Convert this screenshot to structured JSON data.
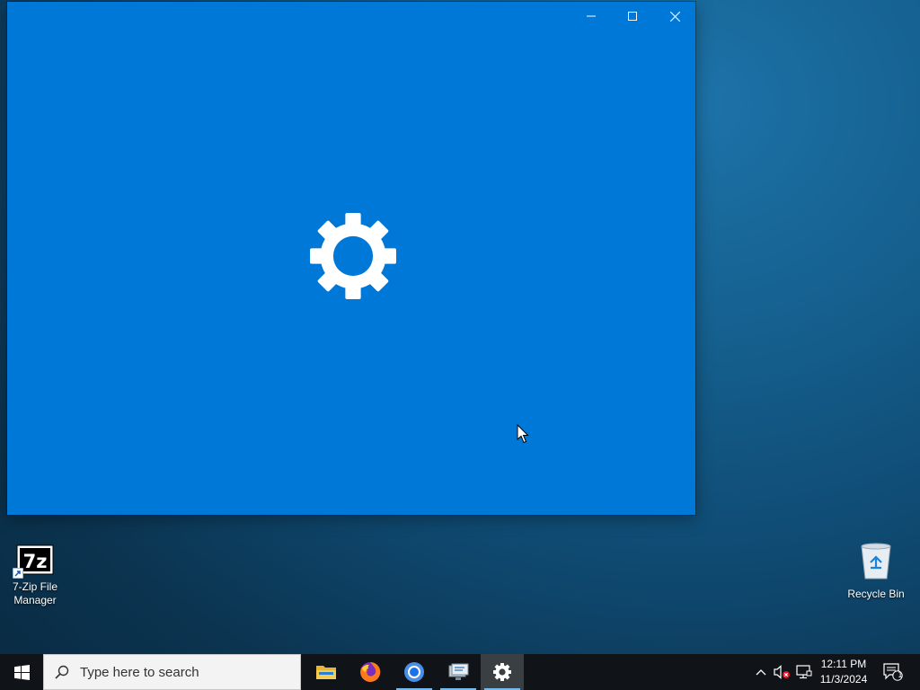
{
  "window": {
    "background": "#0078d7",
    "controls": {
      "minimize_icon": "minimize-icon",
      "maximize_icon": "maximize-icon",
      "close_icon": "close-icon"
    },
    "splash_icon": "gear-icon"
  },
  "desktop": {
    "icons": [
      {
        "label_line1": "7-Zip File",
        "label_line2": "Manager",
        "icon": "7zip-icon",
        "badge": "shortcut-arrow-icon"
      },
      {
        "label": "Recycle Bin",
        "icon": "recycle-bin-icon"
      }
    ]
  },
  "taskbar": {
    "start_icon": "windows-logo-icon",
    "search": {
      "placeholder": "Type here to search",
      "icon": "search-icon"
    },
    "apps": [
      {
        "name": "File Explorer",
        "icon": "file-explorer-icon"
      },
      {
        "name": "Firefox",
        "icon": "firefox-icon"
      },
      {
        "name": "Chrome",
        "icon": "chrome-icon",
        "running": true
      },
      {
        "name": "Network Drive",
        "icon": "network-icon",
        "running": true
      },
      {
        "name": "Settings",
        "icon": "gear-icon",
        "running": true,
        "active": true
      }
    ],
    "tray": {
      "chevron_icon": "chevron-up-icon",
      "volume_icon": "volume-muted-icon",
      "network_icon": "network-icon",
      "clock_time": "12:11 PM",
      "clock_date": "11/3/2024",
      "notification_icon": "notification-icon",
      "notification_count": "1"
    }
  }
}
